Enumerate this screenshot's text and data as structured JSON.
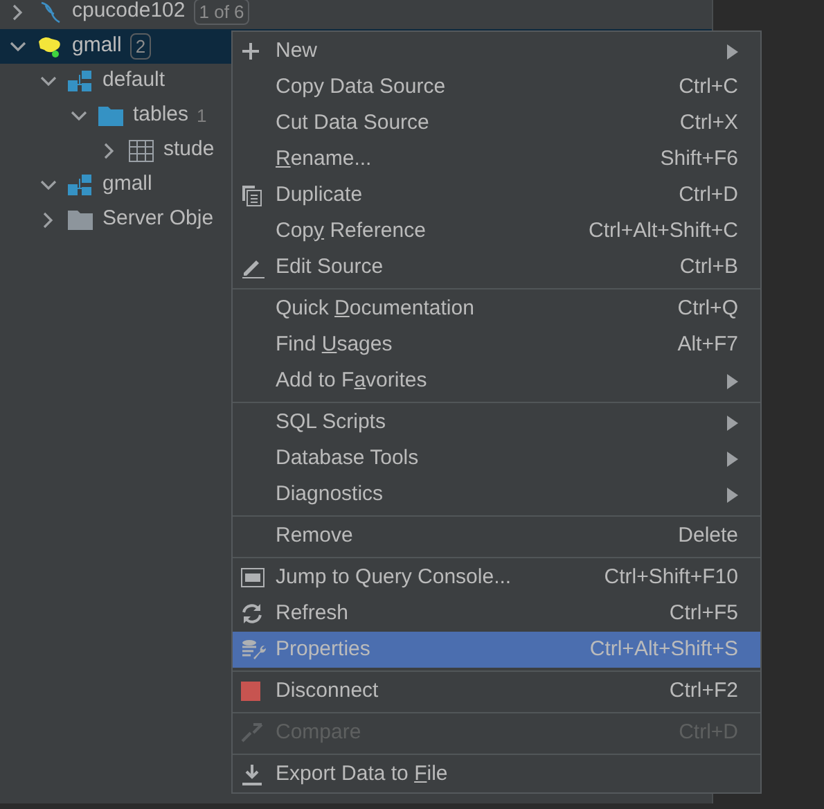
{
  "tree": [
    {
      "label": "cpucode102",
      "badge": "1 of 6",
      "kind": "mysql-connection",
      "expanded": false,
      "selected": false
    },
    {
      "label": "gmall",
      "badge": "2",
      "kind": "hive-connection",
      "expanded": true,
      "selected": true,
      "children": [
        {
          "label": "default",
          "kind": "schema",
          "expanded": true,
          "selected": false,
          "children": [
            {
              "label": "tables",
              "count": "1",
              "kind": "folder",
              "expanded": true,
              "selected": false,
              "children": [
                {
                  "label": "stude",
                  "kind": "table",
                  "expanded": false,
                  "selected": false
                }
              ]
            }
          ]
        },
        {
          "label": "gmall",
          "kind": "schema",
          "expanded": true,
          "selected": false
        },
        {
          "label": "Server Obje",
          "kind": "objects",
          "expanded": false,
          "selected": false
        }
      ]
    }
  ],
  "context_menu": [
    {
      "kind": "new",
      "label": "New",
      "submenu": true,
      "selected": false,
      "disabled": false
    },
    {
      "kind": "plain",
      "label": "Copy Data Source",
      "shortcut": "Ctrl+C",
      "submenu": false,
      "selected": false,
      "disabled": false
    },
    {
      "kind": "plain",
      "label": "Cut Data Source",
      "shortcut": "Ctrl+X",
      "submenu": false,
      "selected": false,
      "disabled": false
    },
    {
      "kind": "plain",
      "label": {
        "mnemonic": "R",
        "after": "ename..."
      },
      "shortcut": "Shift+F6",
      "submenu": false,
      "selected": false,
      "disabled": false
    },
    {
      "kind": "duplicate",
      "label": "Duplicate",
      "shortcut": "Ctrl+D",
      "submenu": false,
      "selected": false,
      "disabled": false
    },
    {
      "kind": "plain",
      "label": {
        "before": "Cop",
        "mnemonic": "y",
        "after": " Reference"
      },
      "shortcut": "Ctrl+Alt+Shift+C",
      "submenu": false,
      "selected": false,
      "disabled": false
    },
    {
      "kind": "edit",
      "label": "Edit Source",
      "shortcut": "Ctrl+B",
      "submenu": false,
      "selected": false,
      "disabled": false
    },
    {
      "kind": "separator"
    },
    {
      "kind": "plain",
      "label": {
        "before": "Quick ",
        "mnemonic": "D",
        "after": "ocumentation"
      },
      "shortcut": "Ctrl+Q",
      "submenu": false,
      "selected": false,
      "disabled": false
    },
    {
      "kind": "plain",
      "label": {
        "before": "Find ",
        "mnemonic": "U",
        "after": "sages"
      },
      "shortcut": "Alt+F7",
      "submenu": false,
      "selected": false,
      "disabled": false
    },
    {
      "kind": "plain",
      "label": {
        "before": "Add to F",
        "mnemonic": "a",
        "after": "vorites"
      },
      "submenu": true,
      "selected": false,
      "disabled": false
    },
    {
      "kind": "separator"
    },
    {
      "kind": "plain",
      "label": "SQL Scripts",
      "submenu": true,
      "selected": false,
      "disabled": false
    },
    {
      "kind": "plain",
      "label": "Database Tools",
      "submenu": true,
      "selected": false,
      "disabled": false
    },
    {
      "kind": "plain",
      "label": "Diagnostics",
      "submenu": true,
      "selected": false,
      "disabled": false
    },
    {
      "kind": "separator"
    },
    {
      "kind": "plain",
      "label": "Remove",
      "shortcut": "Delete",
      "submenu": false,
      "selected": false,
      "disabled": false
    },
    {
      "kind": "separator"
    },
    {
      "kind": "console",
      "label": "Jump to Query Console...",
      "shortcut": "Ctrl+Shift+F10",
      "submenu": false,
      "selected": false,
      "disabled": false
    },
    {
      "kind": "refresh",
      "label": "Refresh",
      "shortcut": "Ctrl+F5",
      "submenu": false,
      "selected": false,
      "disabled": false
    },
    {
      "kind": "properties",
      "label": "Properties",
      "shortcut": "Ctrl+Alt+Shift+S",
      "submenu": false,
      "selected": true,
      "disabled": false
    },
    {
      "kind": "separator"
    },
    {
      "kind": "disconnect",
      "label": "Disconnect",
      "shortcut": "Ctrl+F2",
      "submenu": false,
      "selected": false,
      "disabled": false
    },
    {
      "kind": "separator"
    },
    {
      "kind": "compare",
      "label": "Compare",
      "shortcut": "Ctrl+D",
      "submenu": false,
      "selected": false,
      "disabled": true
    },
    {
      "kind": "separator"
    },
    {
      "kind": "export",
      "label": {
        "before": "Export Data to ",
        "mnemonic": "F",
        "after": "ile"
      },
      "submenu": false,
      "selected": false,
      "disabled": false
    }
  ]
}
